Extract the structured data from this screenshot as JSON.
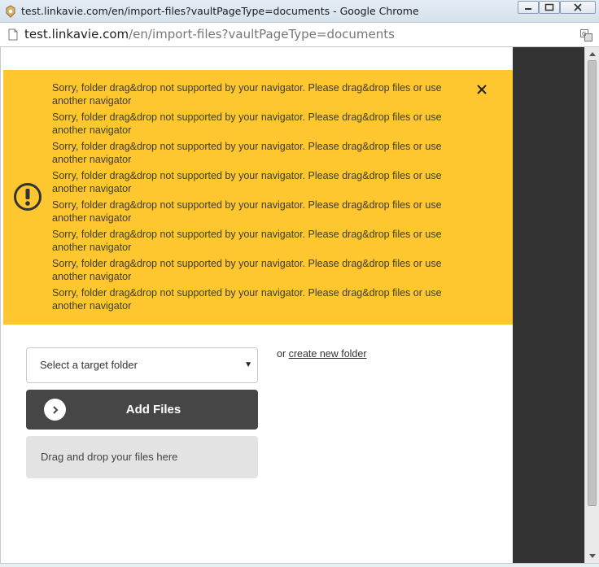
{
  "window": {
    "title": "test.linkavie.com/en/import-files?vaultPageType=documents - Google Chrome"
  },
  "address_bar": {
    "host": "test.linkavie.com",
    "path": "/en/import-files?vaultPageType=documents"
  },
  "alert": {
    "messages": [
      "Sorry, folder drag&drop not supported by your navigator. Please drag&drop files or use another navigator",
      "Sorry, folder drag&drop not supported by your navigator. Please drag&drop files or use another navigator",
      "Sorry, folder drag&drop not supported by your navigator. Please drag&drop files or use another navigator",
      "Sorry, folder drag&drop not supported by your navigator. Please drag&drop files or use another navigator",
      "Sorry, folder drag&drop not supported by your navigator. Please drag&drop files or use another navigator",
      "Sorry, folder drag&drop not supported by your navigator. Please drag&drop files or use another navigator",
      "Sorry, folder drag&drop not supported by your navigator. Please drag&drop files or use another navigator",
      "Sorry, folder drag&drop not supported by your navigator. Please drag&drop files or use another navigator"
    ],
    "background_color": "#fec72f",
    "icon": "exclamation-circle-icon"
  },
  "upload": {
    "folder_select_value": "Select a target folder",
    "or_text": "or",
    "create_folder_link": "create new folder",
    "add_files_label": "Add Files",
    "dropzone_text": "Drag and drop your files here"
  },
  "colors": {
    "add_button": "#464646",
    "side_panel": "#333333",
    "dropzone": "#e3e3e3"
  }
}
